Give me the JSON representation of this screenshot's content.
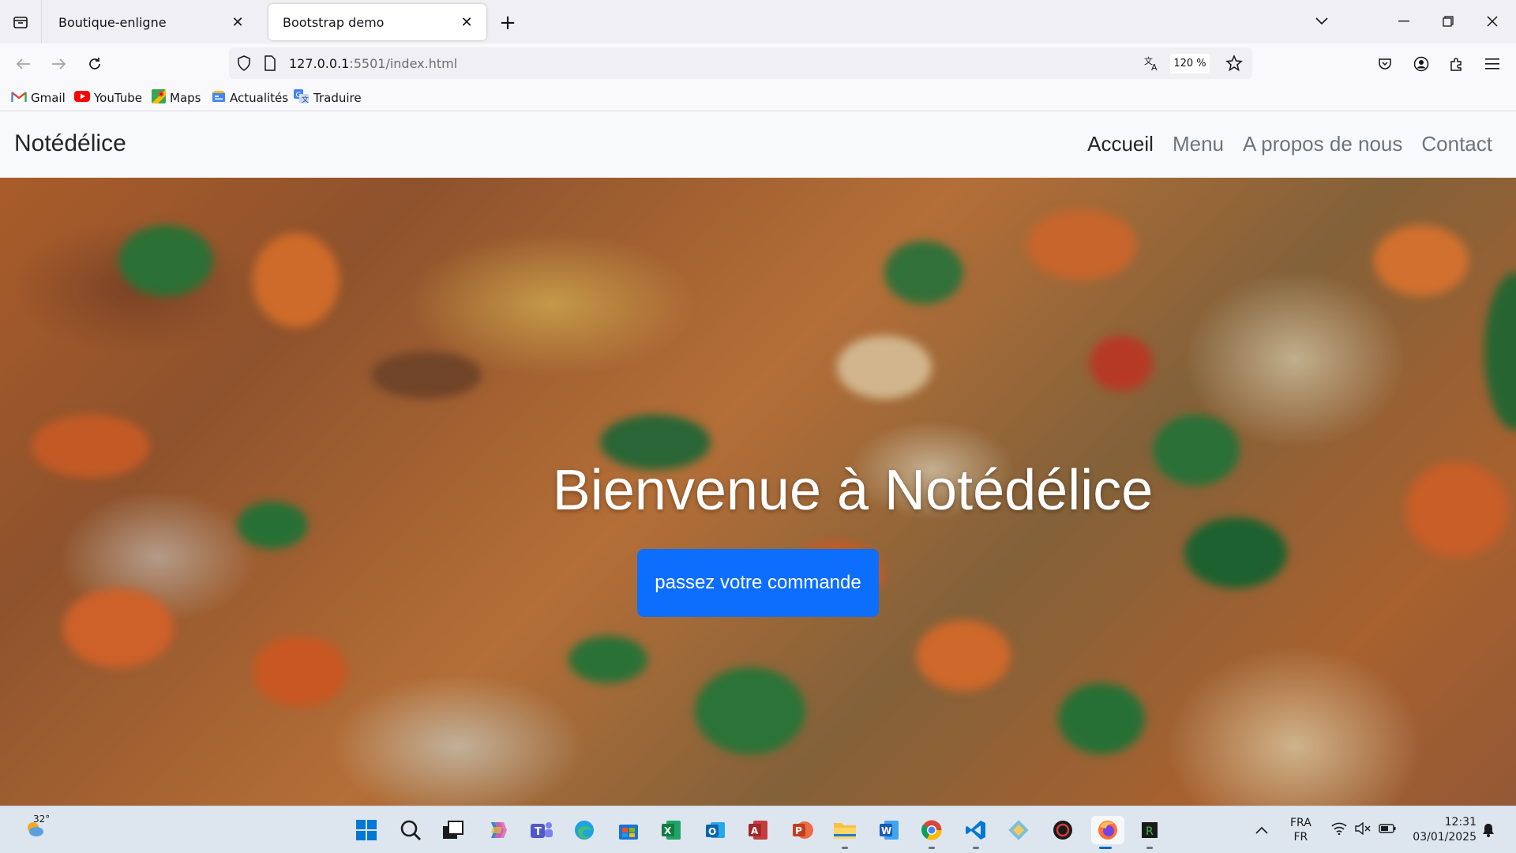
{
  "browser": {
    "tabs": [
      {
        "title": "Boutique-enligne",
        "active": false
      },
      {
        "title": "Bootstrap demo",
        "active": true
      }
    ],
    "new_tab_symbol": "+",
    "url_host": "127.0.0.1",
    "url_rest": ":5501/index.html",
    "zoom": "120 %",
    "bookmarks": [
      {
        "label": "Gmail",
        "icon": "gmail-icon"
      },
      {
        "label": "YouTube",
        "icon": "youtube-icon"
      },
      {
        "label": "Maps",
        "icon": "maps-icon"
      },
      {
        "label": "Actualités",
        "icon": "news-icon"
      },
      {
        "label": "Traduire",
        "icon": "translate-icon"
      }
    ]
  },
  "site": {
    "brand": "Notédélice",
    "nav": [
      {
        "label": "Accueil",
        "active": true
      },
      {
        "label": "Menu",
        "active": false
      },
      {
        "label": "A propos de nous",
        "active": false
      },
      {
        "label": "Contact",
        "active": false
      }
    ],
    "hero": {
      "title": "Bienvenue à Notédélice",
      "cta": "passez votre commande"
    }
  },
  "taskbar": {
    "weather": "32°",
    "language_top": "FRA",
    "language_bottom": "FR",
    "time": "12:31",
    "date": "03/01/2025"
  },
  "colors": {
    "accent": "#0d6efd",
    "navbar_bg": "#f8f9fa",
    "nav_active": "#212529",
    "nav_inactive": "#6c757d"
  }
}
